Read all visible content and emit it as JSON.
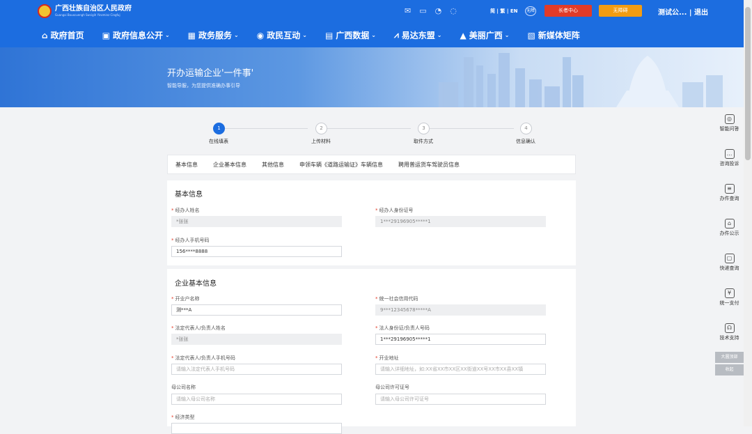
{
  "header": {
    "site_name": "广西壮族自治区人民政府",
    "site_name_en": "Guangxi Bouxcuengh Swcigih Yinzminz Cingfuj",
    "lang": "简 | 繁 | EN",
    "access_label": "无障",
    "elder_center": "长者中心",
    "accessible_mode": "无障碍",
    "user": "测试公... | 退出"
  },
  "nav": {
    "items": [
      {
        "label": "政府首页",
        "icon": "home-icon",
        "glyph": "⌂",
        "chev": ""
      },
      {
        "label": "政府信息公开",
        "icon": "info-icon",
        "glyph": "▣",
        "chev": "⌄"
      },
      {
        "label": "政务服务",
        "icon": "service-icon",
        "glyph": "▦",
        "chev": "⌄"
      },
      {
        "label": "政民互动",
        "icon": "chat-icon",
        "glyph": "◉",
        "chev": "⌄"
      },
      {
        "label": "广西数据",
        "icon": "data-icon",
        "glyph": "▤",
        "chev": "⌄"
      },
      {
        "label": "易达东盟",
        "icon": "asean-icon",
        "glyph": "⩘",
        "chev": "⌄"
      },
      {
        "label": "美丽广西",
        "icon": "scenery-icon",
        "glyph": "▲",
        "chev": "⌄"
      },
      {
        "label": "新媒体矩阵",
        "icon": "media-icon",
        "glyph": "▧",
        "chev": ""
      }
    ]
  },
  "banner": {
    "title": "开办运输企业'一件事'",
    "subtitle": "智能导服，为您提供准确办事引导"
  },
  "steps": [
    {
      "num": "1",
      "label": "在线填表",
      "active": true
    },
    {
      "num": "2",
      "label": "上传材料",
      "active": false
    },
    {
      "num": "3",
      "label": "取件方式",
      "active": false
    },
    {
      "num": "4",
      "label": "信息确认",
      "active": false
    }
  ],
  "tabs": [
    "基本信息",
    "企业基本信息",
    "其他信息",
    "申领车辆《道路运输证》车辆信息",
    "聘用普运货车驾驶员信息"
  ],
  "basic_info": {
    "title": "基本信息",
    "name_label": "经办人姓名",
    "name_value": "*张张",
    "id_label": "经办人身份证号",
    "id_value": "1***29196905*****1",
    "phone_label": "经办人手机号码",
    "phone_value": "156****8888"
  },
  "enterprise_info": {
    "title": "企业基本信息",
    "company_label": "开业户名称",
    "company_value": "测***A",
    "credit_label": "统一社会信用代码",
    "credit_value": "9***12345678*****A",
    "legal_name_label": "法定代表人/负责人姓名",
    "legal_name_value": "*张张",
    "legal_id_label": "法人身份证/负责人号码",
    "legal_id_value": "1***29196905*****1",
    "legal_phone_label": "法定代表人/负责人手机号码",
    "legal_phone_placeholder": "请输入法定代表人手机号码",
    "address_label": "开业地址",
    "address_placeholder": "请输入详细地址，如:XX省XX市XX区XX街道XX号XX市XX县XX镇",
    "parent_name_label": "母公司名称",
    "parent_name_placeholder": "请输入母公司名称",
    "parent_license_label": "母公司许可证号",
    "parent_license_placeholder": "请输入母公司许可证号",
    "econ_type_label": "经济类型"
  },
  "right_panel": {
    "items": [
      {
        "label": "智能问答",
        "icon": "robot-icon",
        "glyph": "◎"
      },
      {
        "label": "咨询投诉",
        "icon": "consult-icon",
        "glyph": "…"
      },
      {
        "label": "办件查询",
        "icon": "query-icon",
        "glyph": "≡"
      },
      {
        "label": "办件公示",
        "icon": "notice-icon",
        "glyph": "⌂"
      },
      {
        "label": "快递查询",
        "icon": "express-icon",
        "glyph": "▢"
      },
      {
        "label": "统一支付",
        "icon": "payment-icon",
        "glyph": "¥"
      },
      {
        "label": "技术支持",
        "icon": "support-icon",
        "glyph": "☊"
      }
    ],
    "elder_mode": "大圆顶部",
    "collapse": "收起"
  },
  "colors": {
    "primary": "#1c6de0",
    "required": "#e23b28",
    "elder_btn": "#e23b28",
    "access_btn": "#f39c12"
  }
}
